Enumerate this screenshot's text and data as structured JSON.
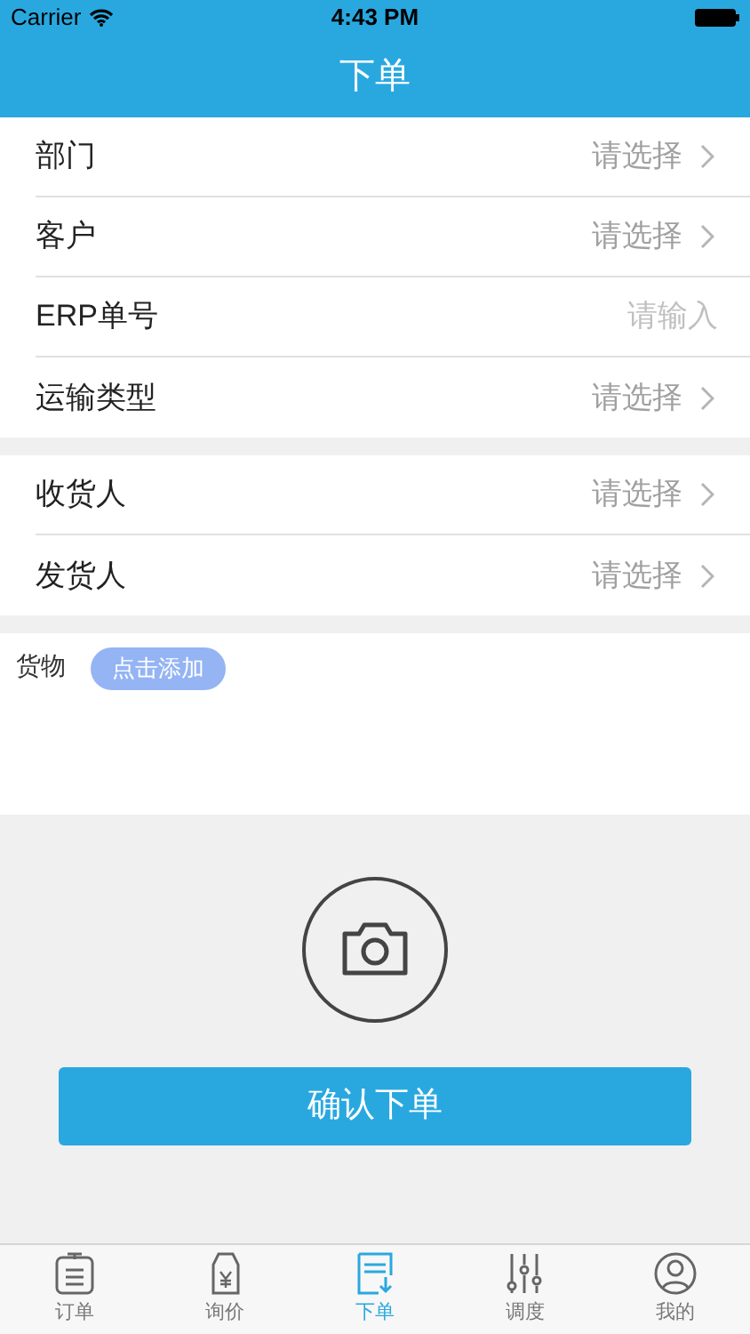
{
  "status_bar": {
    "carrier": "Carrier",
    "time": "4:43 PM"
  },
  "nav": {
    "title": "下单"
  },
  "form_groups": [
    [
      {
        "label": "部门",
        "kind": "select",
        "placeholder": "请选择"
      },
      {
        "label": "客户",
        "kind": "select",
        "placeholder": "请选择"
      },
      {
        "label": "ERP单号",
        "kind": "input",
        "placeholder": "请输入"
      },
      {
        "label": "运输类型",
        "kind": "select",
        "placeholder": "请选择"
      }
    ],
    [
      {
        "label": "收货人",
        "kind": "select",
        "placeholder": "请选择"
      },
      {
        "label": "发货人",
        "kind": "select",
        "placeholder": "请选择"
      }
    ]
  ],
  "goods": {
    "label": "货物",
    "add_button": "点击添加"
  },
  "submit_button": "确认下单",
  "tab_bar": [
    {
      "label": "订单",
      "selected": false
    },
    {
      "label": "询价",
      "selected": false
    },
    {
      "label": "下单",
      "selected": true
    },
    {
      "label": "调度",
      "selected": false
    },
    {
      "label": "我的",
      "selected": false
    }
  ]
}
